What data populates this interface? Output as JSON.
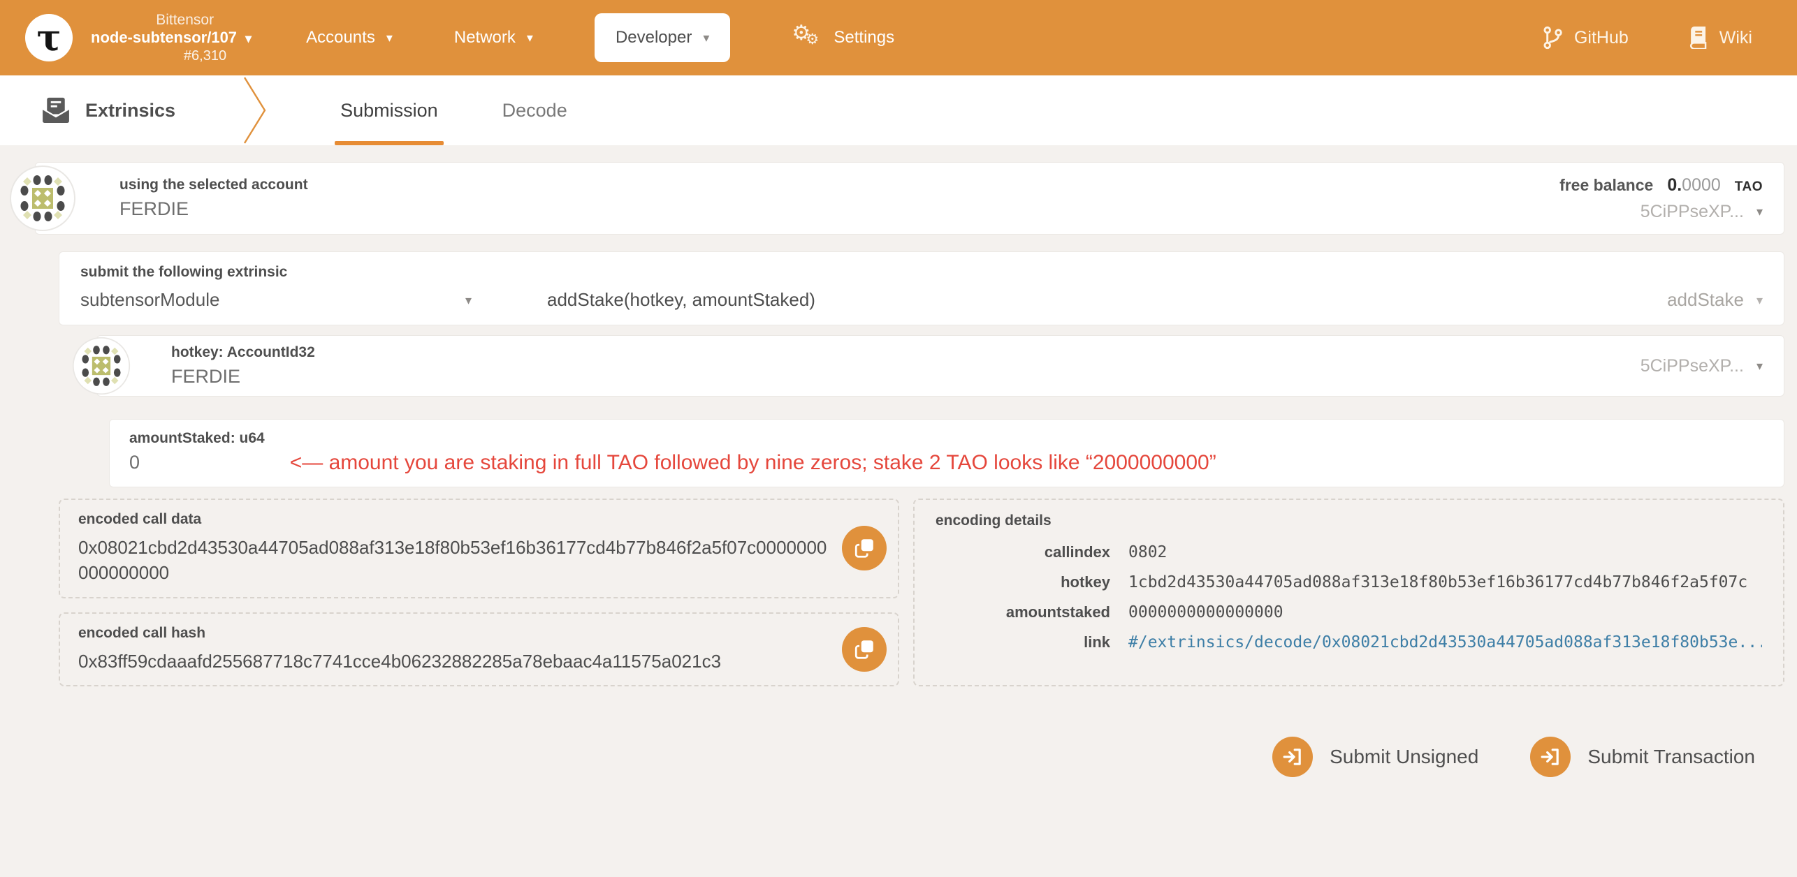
{
  "colors": {
    "accent": "#e0913c",
    "tab_underline": "#e78c34",
    "link": "#3d7ea6",
    "annotation_red": "#e5473c",
    "page_bg": "#f4f1ee"
  },
  "icons": {
    "caret_down": "▾",
    "gear": "⚙",
    "logo_glyph": "τ"
  },
  "navbar": {
    "chain_name": "Bittensor",
    "node_version": "node-subtensor/107",
    "block_number": "#6,310",
    "menu_accounts": "Accounts",
    "menu_network": "Network",
    "menu_developer": "Developer",
    "menu_settings": "Settings",
    "link_github": "GitHub",
    "link_wiki": "Wiki"
  },
  "tabbar": {
    "section_label": "Extrinsics",
    "tab_submission": "Submission",
    "tab_decode": "Decode"
  },
  "account": {
    "label": "using the selected account",
    "name": "FERDIE",
    "balance_label": "free balance",
    "balance_value": "0.0000",
    "balance_unit": "TAO",
    "address_short": "5CiPPseXP..."
  },
  "extrinsic": {
    "label": "submit the following extrinsic",
    "module": "subtensorModule",
    "call_signature": "addStake(hotkey, amountStaked)",
    "call_name": "addStake"
  },
  "params": {
    "hotkey": {
      "label": "hotkey: AccountId32",
      "name": "FERDIE",
      "address_short": "5CiPPseXP..."
    },
    "amount": {
      "label": "amountStaked: u64",
      "value": "0",
      "annotation": "<— amount you are staking in full TAO followed by nine zeros; stake 2 TAO looks like “2000000000”"
    }
  },
  "outputs": {
    "call_data_label": "encoded call data",
    "call_data": "0x08021cbd2d43530a44705ad088af313e18f80b53ef16b36177cd4b77b846f2a5f07c0000000000000000",
    "call_hash_label": "encoded call hash",
    "call_hash": "0x83ff59cdaaafd255687718c7741cce4b06232882285a78ebaac4a11575a021c3",
    "details": {
      "title": "encoding details",
      "rows": [
        {
          "label": "callindex",
          "value": "0802"
        },
        {
          "label": "hotkey",
          "value": "1cbd2d43530a44705ad088af313e18f80b53ef16b36177cd4b77b846f2a5f07c"
        },
        {
          "label": "amountstaked",
          "value": "0000000000000000"
        },
        {
          "label": "link",
          "value": "#/extrinsics/decode/0x08021cbd2d43530a44705ad088af313e18f80b53e..."
        }
      ]
    }
  },
  "actions": {
    "submit_unsigned": "Submit Unsigned",
    "submit_transaction": "Submit Transaction"
  }
}
